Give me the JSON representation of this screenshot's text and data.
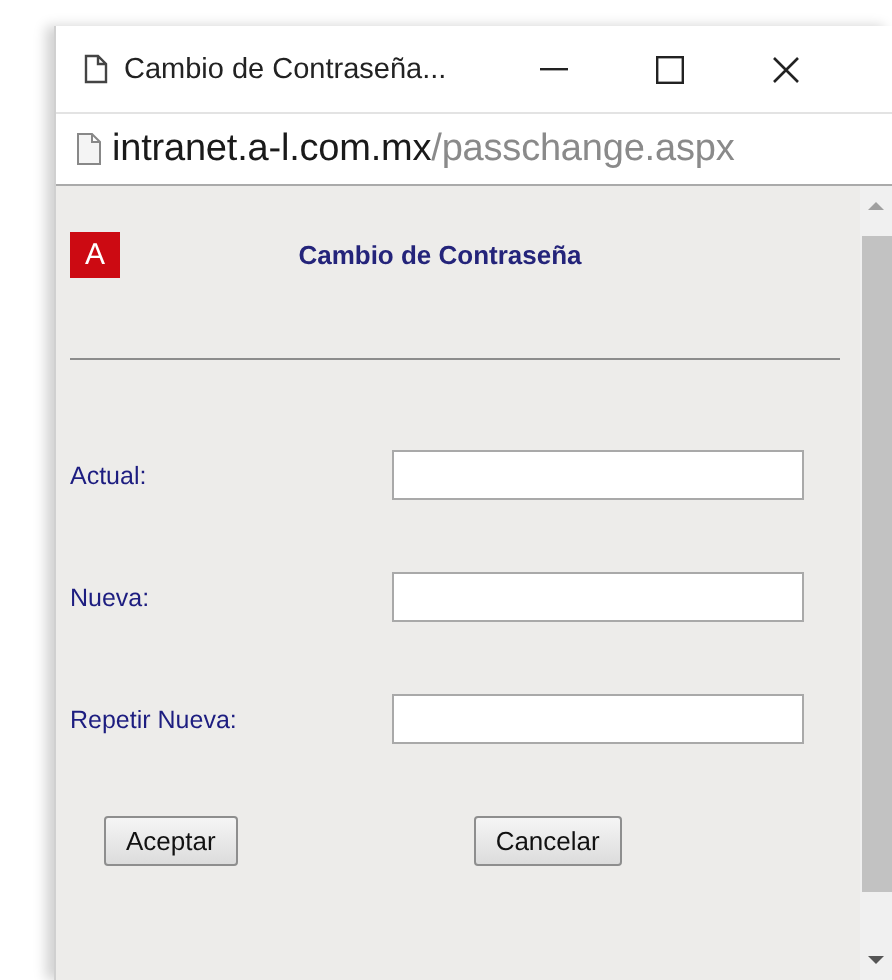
{
  "window": {
    "title": "Cambio de Contraseña..."
  },
  "address_bar": {
    "host": "intranet.a-l.com.mx",
    "path": "/passchange.aspx"
  },
  "logo": {
    "letter": "A"
  },
  "heading": "Cambio de Contraseña",
  "fields": [
    {
      "label": "Actual:"
    },
    {
      "label": "Nueva:"
    },
    {
      "label": "Repetir Nueva:"
    }
  ],
  "buttons": [
    "Aceptar",
    "Cancelar"
  ]
}
